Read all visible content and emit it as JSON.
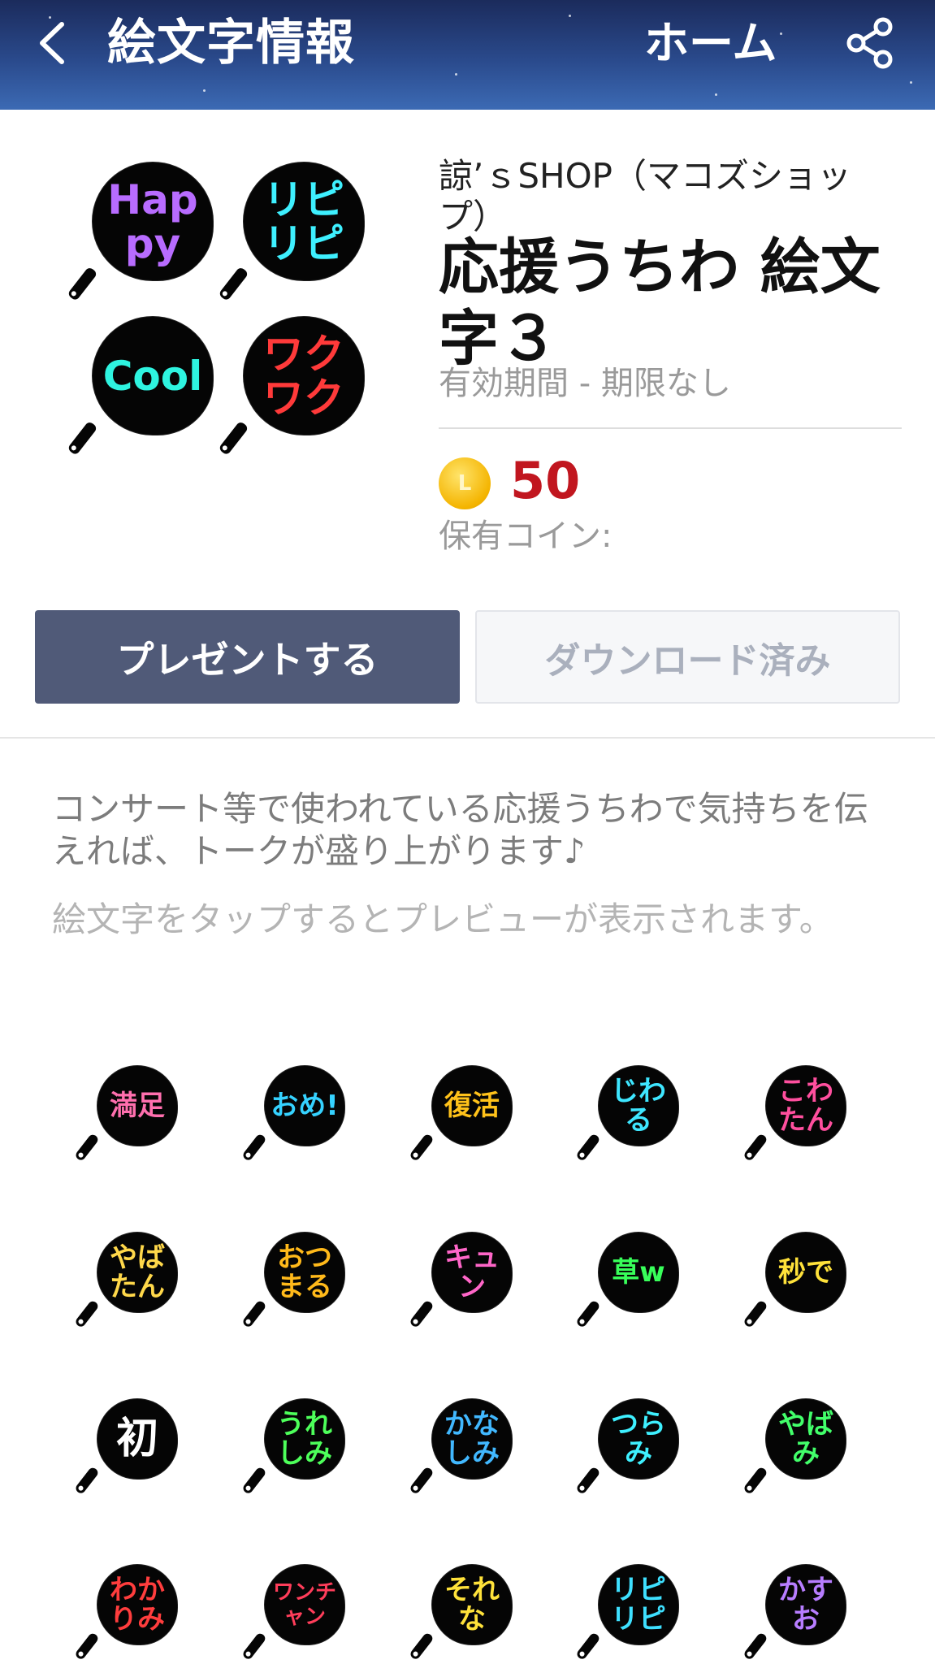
{
  "header": {
    "title": "絵文字情報",
    "home_label": "ホーム"
  },
  "product": {
    "author": "諒’ｓSHOP（マコズショップ）",
    "title": "応援うちわ 絵文字３",
    "validity": "有効期間 - 期限なし",
    "coin_symbol": "L",
    "price": "50",
    "owned_coins": "保有コイン:",
    "thumbnails": [
      {
        "text": "Happy",
        "color": "#b86cff"
      },
      {
        "text": "リピリピ",
        "color": "#3ef0ff"
      },
      {
        "text": "Cool",
        "color": "#2ef4e0"
      },
      {
        "text": "ワクワク",
        "color": "#ff3a3a"
      }
    ]
  },
  "actions": {
    "present_label": "プレゼントする",
    "downloaded_label": "ダウンロード済み"
  },
  "description": "コンサート等で使われている応援うちわで気持ちを伝えれば、トークが盛り上がります♪",
  "hint": "絵文字をタップするとプレビューが表示されます。",
  "emojis": [
    {
      "text": "満足",
      "color": "#ff6fae"
    },
    {
      "text": "おめ!",
      "color": "#35d2ff"
    },
    {
      "text": "復活",
      "color": "#ffc21a"
    },
    {
      "text": "じわる",
      "color": "#3ee6ff"
    },
    {
      "text": "こわたん",
      "color": "#ff4f9e"
    },
    {
      "text": "やばたん",
      "color": "#ffd84a"
    },
    {
      "text": "おつまる",
      "color": "#ffb91a"
    },
    {
      "text": "キュン",
      "color": "#ff66c8"
    },
    {
      "text": "草w",
      "color": "#38ff5a"
    },
    {
      "text": "秒で",
      "color": "#ffe23a"
    },
    {
      "text": "初",
      "color": "#ffffff"
    },
    {
      "text": "うれしみ",
      "color": "#4dff5a"
    },
    {
      "text": "かなしみ",
      "color": "#41b8ff"
    },
    {
      "text": "つらみ",
      "color": "#3ef0ff"
    },
    {
      "text": "やばみ",
      "color": "#42ff6a"
    },
    {
      "text": "わかりみ",
      "color": "#ff3d3d"
    },
    {
      "text": "ワンチャン",
      "color": "#ff3d5a"
    },
    {
      "text": "それな",
      "color": "#ffe23a"
    },
    {
      "text": "リピリピ",
      "color": "#3ee0ff"
    },
    {
      "text": "かすお",
      "color": "#b77dff"
    }
  ]
}
